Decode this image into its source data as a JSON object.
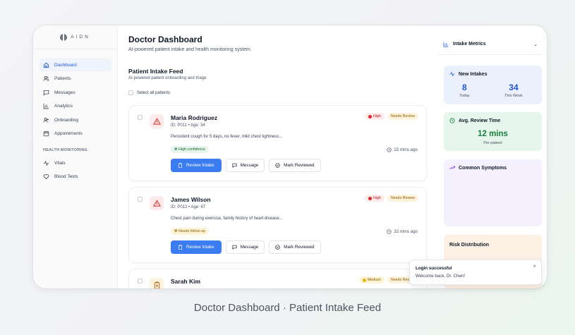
{
  "brand": {
    "name": "AIDN"
  },
  "sidebar": {
    "items": [
      {
        "label": "Dashboard",
        "icon": "home-icon",
        "active": true
      },
      {
        "label": "Patients",
        "icon": "users-icon"
      },
      {
        "label": "Messages",
        "icon": "message-icon"
      },
      {
        "label": "Analytics",
        "icon": "bar-chart-icon"
      },
      {
        "label": "Onboarding",
        "icon": "user-plus-icon"
      },
      {
        "label": "Appointments",
        "icon": "calendar-icon"
      }
    ],
    "section_label": "HEALTH MONITORING",
    "health_items": [
      {
        "label": "Vitals",
        "icon": "activity-icon"
      },
      {
        "label": "Blood Tests",
        "icon": "heart-icon"
      }
    ]
  },
  "header": {
    "title": "Doctor Dashboard",
    "subtitle": "AI-powered patient intake and health monitoring system."
  },
  "feed": {
    "title": "Patient Intake Feed",
    "subtitle": "AI-powered patient onboarding and triage",
    "select_all": "Select all patients",
    "cards": [
      {
        "name": "Maria Rodriguez",
        "meta": "ID: P011 • Age: 34",
        "note": "Persistent cough for 5 days, no fever, mild chest tightness...",
        "priority": "High",
        "status": "Needs Review",
        "confidence": "High confidence",
        "time": "15 mins ago",
        "icon": "alert-triangle-icon"
      },
      {
        "name": "James Wilson",
        "meta": "ID: P012 • Age: 67",
        "note": "Chest pain during exercise, family history of heart disease...",
        "priority": "High",
        "status": "Needs Review",
        "confidence": "Needs follow-up",
        "time": "32 mins ago",
        "icon": "alert-triangle-icon"
      },
      {
        "name": "Sarah Kim",
        "priority": "Medium",
        "status": "Needs Review",
        "icon": "clipboard-icon"
      }
    ],
    "actions": {
      "review": "Review Intake",
      "message": "Message",
      "mark": "Mark Reviewed"
    }
  },
  "metrics": {
    "title": "Intake Metrics",
    "new_intakes": {
      "title": "New Intakes",
      "today_value": "8",
      "today_label": "Today",
      "week_value": "34",
      "week_label": "This Week"
    },
    "avg_review": {
      "title": "Avg. Review Time",
      "value": "12 mins",
      "label": "Per patient"
    },
    "symptoms_title": "Common Symptoms",
    "risk_title": "Risk Distribution"
  },
  "toast": {
    "title": "Login successful",
    "message": "Welcome back, Dr. Chen!"
  },
  "caption": "Doctor Dashboard · Patient Intake Feed",
  "colors": {
    "primary": "#3b7cf0",
    "high": "#dc2626",
    "medium": "#eab308",
    "success": "#16803a"
  }
}
